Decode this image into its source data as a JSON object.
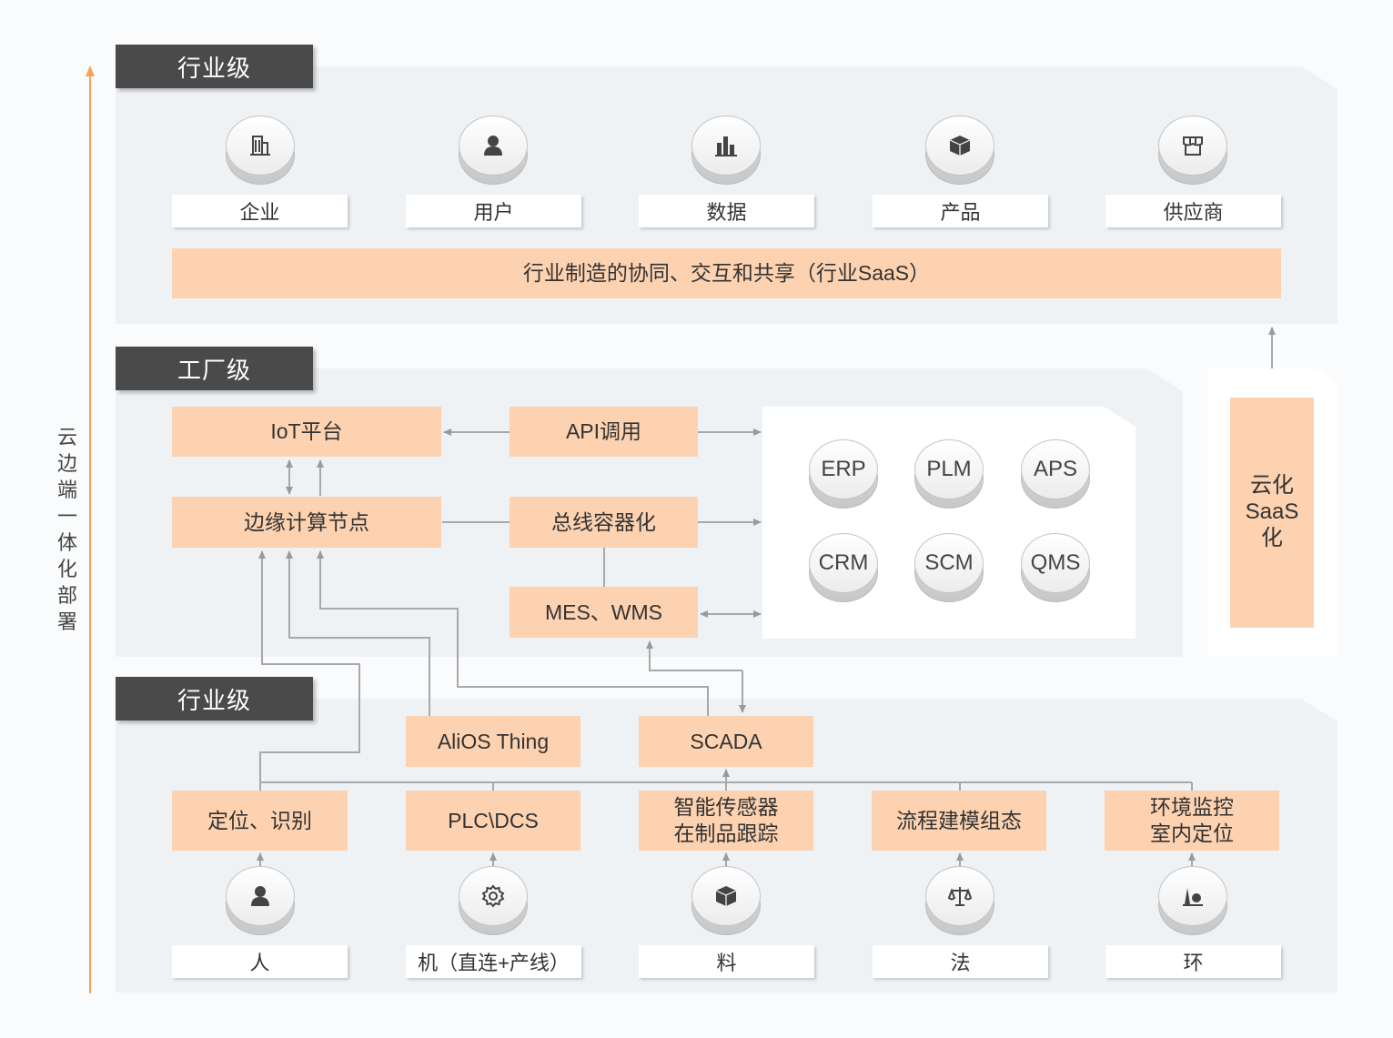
{
  "side_label": "云边端一体化部署",
  "tiers": {
    "top": "行业级",
    "middle": "工厂级",
    "bottom": "行业级"
  },
  "industry_items": [
    "企业",
    "用户",
    "数据",
    "产品",
    "供应商"
  ],
  "industry_icons": [
    "building-icon",
    "user-icon",
    "bar-chart-icon",
    "box-icon",
    "store-icon"
  ],
  "industry_banner": "行业制造的协同、交互和共享（行业SaaS）",
  "factory": {
    "iot": "IoT平台",
    "api": "API调用",
    "edge": "边缘计算节点",
    "bus": "总线容器化",
    "mes": "MES、WMS",
    "systems": [
      "ERP",
      "PLM",
      "APS",
      "CRM",
      "SCM",
      "QMS"
    ]
  },
  "cloud_saas": "云化SaaS化",
  "devices": {
    "alios": "AliOS Thing",
    "scada": "SCADA"
  },
  "sources": [
    "定位、识别",
    "PLC\\DCS",
    "智能传感器在制品跟踪",
    "流程建模组态",
    "环境监控室内定位"
  ],
  "factors": [
    "人",
    "机（直连+产线）",
    "料",
    "法",
    "环"
  ],
  "factor_icons": [
    "person-icon",
    "gear-icon",
    "cube-icon",
    "scale-icon",
    "plant-icon"
  ],
  "colors": {
    "accent": "#fdd2b0",
    "tag": "#4a4a4a",
    "panel": "#eff2f5",
    "arrow": "#f5a25d"
  }
}
